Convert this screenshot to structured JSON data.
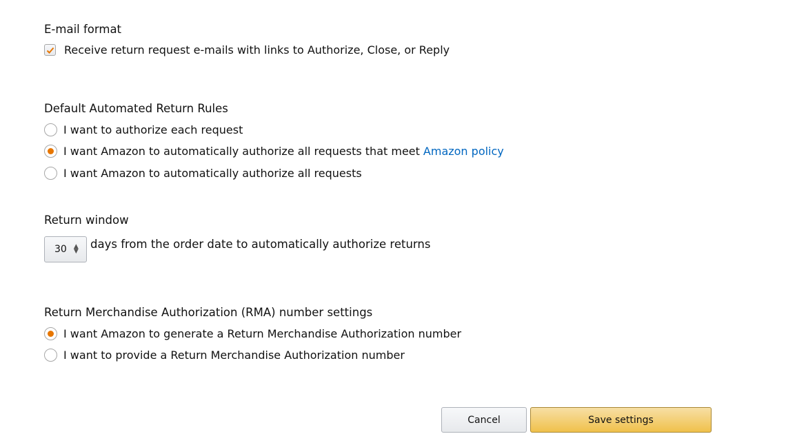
{
  "email_format": {
    "heading": "E-mail format",
    "checkbox": {
      "label": "Receive return request e-mails with links to Authorize, Close, or Reply",
      "checked": true
    }
  },
  "return_rules": {
    "heading": "Default Automated Return Rules",
    "options": [
      {
        "label": "I want to authorize each request",
        "selected": false
      },
      {
        "label": "I want Amazon to automatically authorize all requests that meet",
        "link": "Amazon policy",
        "selected": true
      },
      {
        "label": "I want Amazon to automatically authorize all requests",
        "selected": false
      }
    ]
  },
  "return_window": {
    "heading": "Return window",
    "days_value": "30",
    "description": "days from the order date to automatically authorize returns"
  },
  "rma": {
    "heading": "Return Merchandise Authorization (RMA) number settings",
    "options": [
      {
        "label": "I want Amazon to generate a Return Merchandise Authorization number",
        "selected": true
      },
      {
        "label": "I want to provide a Return Merchandise Authorization number",
        "selected": false
      }
    ]
  },
  "actions": {
    "cancel_label": "Cancel",
    "save_label": "Save settings"
  },
  "colors": {
    "accent": "#e77600",
    "link": "#0066c0",
    "save_button": "#f0c14b"
  }
}
